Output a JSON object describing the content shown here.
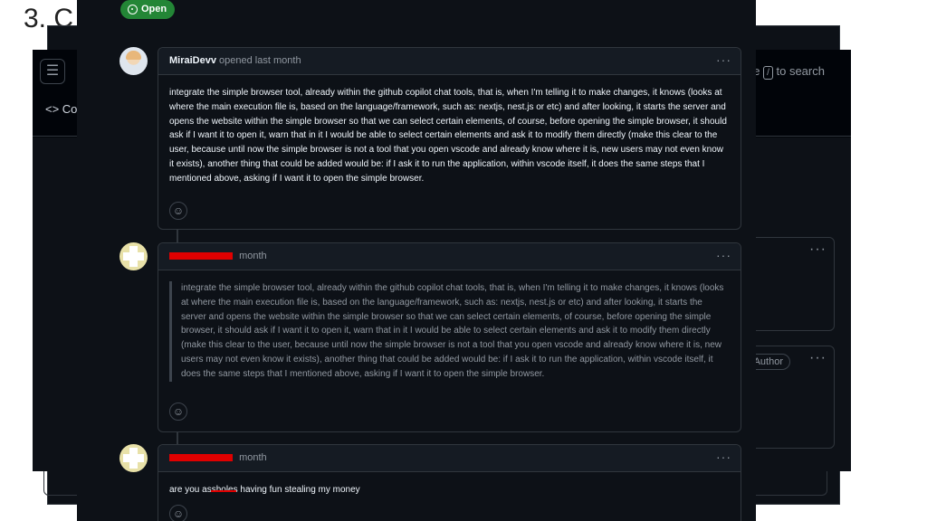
{
  "slide": {
    "heading": "3. C"
  },
  "background": {
    "menu_icon": "hamburger-icon",
    "code_tab": "<> Co",
    "search": {
      "prefix": "pe",
      "key": "/",
      "suffix": "to search"
    },
    "author_badge": "Author",
    "menu_dots": "···"
  },
  "issue": {
    "state": "Open",
    "state_color": "#238636"
  },
  "comments": [
    {
      "author": "MiraiDevv",
      "meta": "opened last month",
      "body": "integrate the simple browser tool, already within the github copilot chat tools, that is, when I'm telling it to make changes, it knows (looks at where the main execution file is, based on the language/framework, such as: nextjs, nest.js or etc) and after looking, it starts the server and opens the website within the simple browser so that we can select certain elements, of course, before opening the simple browser, it should ask if I want it to open it, warn that in it I would be able to select certain elements and ask it to modify them directly (make this clear to the user, because until now the simple browser is not a tool that you open vscode and already know where it is, new users may not even know it exists), another thing that could be added would be: if I ask it to run the application, within vscode itself, it does the same steps that I mentioned above, asking if I want it to open the simple browser.",
      "menu": "···"
    },
    {
      "author": "",
      "meta": "month",
      "quote": "integrate the simple browser tool, already within the github copilot chat tools, that is, when I'm telling it to make changes, it knows (looks at where the main execution file is, based on the language/framework, such as: nextjs, nest.js or etc) and after looking, it starts the server and opens the website within the simple browser so that we can select certain elements, of course, before opening the simple browser, it should ask if I want it to open it, warn that in it I would be able to select certain elements and ask it to modify them directly (make this clear to the user, because until now the simple browser is not a tool that you open vscode and already know where it is, new users may not even know it exists), another thing that could be added would be: if I ask it to run the application, within vscode itself, it does the same steps that I mentioned above, asking if I want it to open the simple browser.",
      "menu": "···"
    },
    {
      "author": "",
      "meta": "month",
      "body_pre": "are you a",
      "body_struck": "ssholes",
      "body_post": " having fun stealing my money",
      "menu": "···"
    }
  ],
  "redaction_color": "#e00000",
  "reaction_icon": "smiley-icon"
}
